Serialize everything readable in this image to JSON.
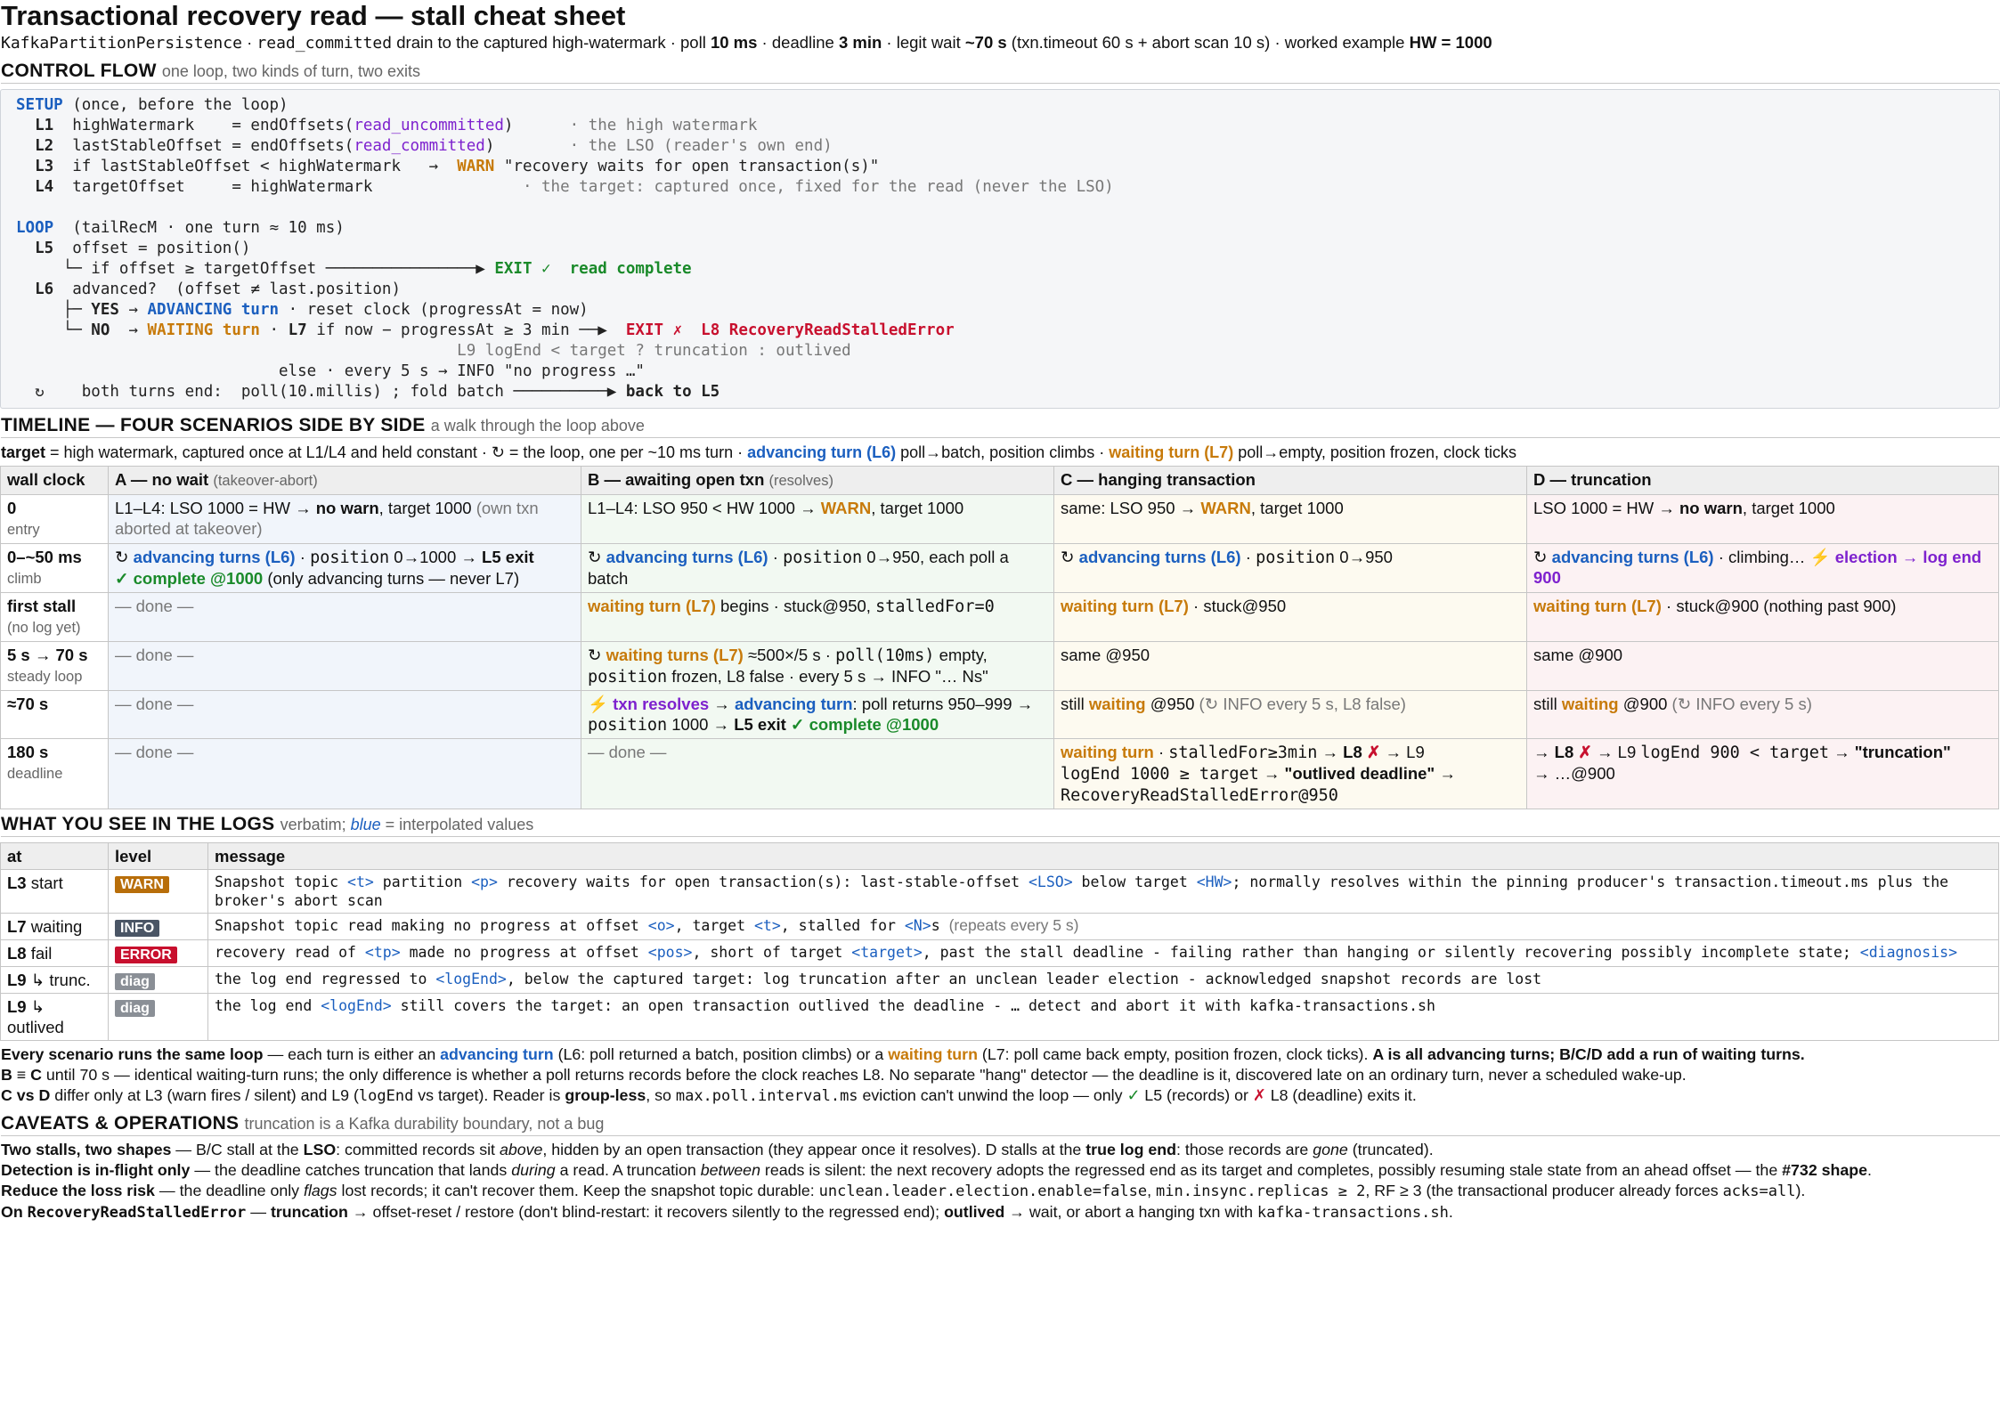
{
  "title": "Transactional recovery read — stall cheat sheet",
  "subtitle": {
    "class_name": "KafkaPartitionPersistence",
    "mode": "read_committed",
    "s1": " drain to the captured high-watermark · poll ",
    "poll": "10 ms",
    "s2": " · deadline ",
    "deadline": "3 min",
    "s3": " · legit wait ",
    "legit_wait": "~70 s",
    "s4": " (txn.timeout 60 s + abort scan 10 s) · worked example ",
    "example": "HW = 1000"
  },
  "control_flow": {
    "heading": "CONTROL FLOW",
    "note": "one loop, two kinds of turn, two exits",
    "setup_kw": "SETUP",
    "setup_note": " (once, before the loop)",
    "l1": "L1",
    "l1a": "  highWatermark    = endOffsets(",
    "l1b": "read_uncommitted",
    "l1c": ")      ",
    "l1d": "· the high watermark",
    "l2": "L2",
    "l2a": "  lastStableOffset = endOffsets(",
    "l2b": "read_committed",
    "l2c": ")        ",
    "l2d": "· the LSO (reader's own end)",
    "l3": "L3",
    "l3a": "  if lastStableOffset < highWatermark   →  ",
    "l3b": "WARN",
    "l3c": " \"recovery waits for open transaction(s)\"",
    "l4": "L4",
    "l4a": "  targetOffset     = highWatermark                ",
    "l4b": "· the target: captured once, fixed for the read (never the LSO)",
    "loop_kw": "LOOP",
    "loop_note": "  (tailRecM · one turn ≈ 10 ms)",
    "l5": "L5",
    "l5a": "  offset = position()",
    "l5b": "     └─ if offset ≥ targetOffset ────────────────▶ ",
    "l5c": "EXIT ✓  read complete",
    "l6": "L6",
    "l6a": "  advanced?  (offset ≠ last.position)",
    "l6b": "     ├─ ",
    "l6c": "YES",
    "l6d": " → ",
    "l6e": "ADVANCING turn",
    "l6f": " · reset clock (progressAt = now)",
    "l6g": "     └─ ",
    "l6h": "NO",
    "l6i": "  → ",
    "l6j": "WAITING turn",
    "l6k": " · ",
    "l6l": "L7",
    "l6m": " if now − progressAt ≥ 3 min ──▶  ",
    "l6n": "EXIT ✗  L8 RecoveryReadStalledError",
    "l9": "                                               L9 logEnd < target ? truncation : outlived",
    "else": "                            else · every 5 s → INFO \"no progress …\"",
    "loop_icon": "↻",
    "end_a": "    both turns end:  poll(10.millis) ; fold batch ──────────▶ ",
    "end_b": "back to L5"
  },
  "timeline": {
    "heading": "TIMELINE — FOUR SCENARIOS SIDE BY SIDE",
    "note": "a walk through the loop above",
    "legend": {
      "a1": "target",
      "a2": " = high watermark, captured once at L1/L4 and held constant · ↻ = the loop, one per ~10 ms turn · ",
      "a3": "advancing turn (L6)",
      "a4": " poll→batch, position climbs · ",
      "a5": "waiting turn (L7)",
      "a6": " poll→empty, position frozen, clock ticks"
    },
    "headers": {
      "wall": "wall clock",
      "a": "A — no wait",
      "a_note": "(takeover-abort)",
      "b": "B — awaiting open txn",
      "b_note": "(resolves)",
      "c": "C — hanging transaction",
      "d": "D — truncation"
    },
    "rows": {
      "r0": {
        "t": "0",
        "s": "entry"
      },
      "r1": {
        "t": "0–~50 ms",
        "s": "climb"
      },
      "r2": {
        "t": "first stall",
        "s": "(no log yet)"
      },
      "r3": {
        "t": "5 s → 70 s",
        "s": "steady loop"
      },
      "r4": {
        "t": "≈70 s"
      },
      "r5": {
        "t": "180 s",
        "s": "deadline"
      }
    },
    "cells": {
      "r0a1": "L1–L4: LSO 1000 = HW → ",
      "r0a2": "no warn",
      "r0a3": ", target 1000 ",
      "r0a4": "(own txn aborted at takeover)",
      "r0b1": "L1–L4: LSO 950 < HW 1000 → ",
      "r0b2": "WARN",
      "r0b3": ", target 1000",
      "r0c1": "same: LSO 950 → ",
      "r0c2": "WARN",
      "r0c3": ", target 1000",
      "r0d1": "LSO 1000 = HW → ",
      "r0d2": "no warn",
      "r0d3": ", target 1000",
      "r1a1": "↻ ",
      "r1a2": "advancing turns (L6)",
      "r1a3": " · ",
      "r1a4": "position",
      "r1a5": " 0→1000 → ",
      "r1a6": "L5 exit",
      "r1a7": "✓ complete @1000",
      "r1a8": " (only advancing turns — never L7)",
      "r1b1": "↻ ",
      "r1b2": "advancing turns (L6)",
      "r1b3": " · ",
      "r1b4": "position",
      "r1b5": " 0→950, each poll a batch",
      "r1c1": "↻ ",
      "r1c2": "advancing turns (L6)",
      "r1c3": " · ",
      "r1c4": "position",
      "r1c5": " 0→950",
      "r1d1": "↻ ",
      "r1d2": "advancing turns (L6)",
      "r1d3": " · climbing… ",
      "r1d4": "⚡ election → log end 900",
      "done": "— done —",
      "r2b1": "waiting turn (L7)",
      "r2b2": " begins · stuck@950, ",
      "r2b3": "stalledFor=0",
      "r2c1": "waiting turn (L7)",
      "r2c2": " · stuck@950",
      "r2d1": "waiting turn (L7)",
      "r2d2": " · stuck@900 (nothing past 900)",
      "r3b1": "↻ ",
      "r3b2": "waiting turns (L7)",
      "r3b3": " ≈500×/5 s · ",
      "r3b4": "poll(10ms)",
      "r3b5": " empty, ",
      "r3b6": "position",
      "r3b7": " frozen, L8 false · every 5 s → INFO \"… Ns\"",
      "r3c1": "same @950",
      "r3d1": "same @900",
      "r4b1": "⚡ txn resolves",
      "r4b2": " → ",
      "r4b3": "advancing turn",
      "r4b4": ": poll returns 950–999 → ",
      "r4b5": "position",
      "r4b6": " 1000 → ",
      "r4b7": "L5 exit",
      "r4b8": " ✓ complete @1000",
      "r4c1": "still ",
      "r4c2": "waiting",
      "r4c3": " @950  ",
      "r4c4": "(↻ INFO every 5 s, L8 false)",
      "r4d1": "still ",
      "r4d2": "waiting",
      "r4d3": " @900  ",
      "r4d4": "(↻ INFO every 5 s)",
      "r5c1": "waiting turn",
      "r5c2": " · ",
      "r5c3": "stalledFor≥3min",
      "r5c4": " → ",
      "r5c5": "L8",
      "r5c6": " ✗",
      "r5c7": " → L9 ",
      "r5c8": "logEnd 1000 ≥ target",
      "r5c9": " → ",
      "r5c10": "\"outlived deadline\"",
      "r5c11": " → ",
      "r5c12": "RecoveryReadStalledError@950",
      "r5d1": "→ ",
      "r5d2": "L8",
      "r5d3": " ✗",
      "r5d4": " → L9 ",
      "r5d5": "logEnd 900 < target",
      "r5d6": " → ",
      "r5d7": "\"truncation\"",
      "r5d8": " → …@900"
    }
  },
  "logs": {
    "heading": "WHAT YOU SEE IN THE LOGS",
    "note_a": "verbatim; ",
    "note_b": "blue",
    "note_c": " = interpolated values",
    "headers": {
      "at": "at",
      "level": "level",
      "message": "message"
    },
    "rows": [
      {
        "at_a": "L3",
        "at_b": " start",
        "level": "WARN"
      },
      {
        "at_a": "L7",
        "at_b": " waiting",
        "level": "INFO"
      },
      {
        "at_a": "L8",
        "at_b": " fail",
        "level": "ERROR"
      },
      {
        "at_a": "L9",
        "at_b": " ↳ trunc.",
        "level": "diag"
      },
      {
        "at_a": "L9",
        "at_b": " ↳ outlived",
        "level": "diag"
      }
    ],
    "m0": {
      "a": "Snapshot topic ",
      "b": "<t>",
      "c": " partition ",
      "d": "<p>",
      "e": " recovery waits for open transaction(s): last-stable-offset ",
      "f": "<LSO>",
      "g": " below target ",
      "h": "<HW>",
      "i": "; normally resolves within the pinning producer's transaction.timeout.ms plus the broker's abort scan"
    },
    "m1": {
      "a": "Snapshot topic read making no progress at offset ",
      "b": "<o>",
      "c": ", target ",
      "d": "<t>",
      "e": ", stalled for ",
      "f": "<N>",
      "g": "s  ",
      "h": "(repeats every 5 s)"
    },
    "m2": {
      "a": "recovery read of ",
      "b": "<tp>",
      "c": " made no progress at offset ",
      "d": "<pos>",
      "e": ", short of target ",
      "f": "<target>",
      "g": ", past the stall deadline - failing rather than hanging or silently recovering possibly incomplete state; ",
      "h": "<diagnosis>"
    },
    "m3": {
      "a": "the log end regressed to ",
      "b": "<logEnd>",
      "c": ", below the captured target: log truncation after an unclean leader election - acknowledged snapshot records are lost"
    },
    "m4": {
      "a": "the log end ",
      "b": "<logEnd>",
      "c": " still covers the target: an open transaction outlived the deadline - … detect and abort it with kafka-transactions.sh"
    }
  },
  "summary": {
    "p1": {
      "a": "Every scenario runs the same loop",
      "b": " — each turn is either an ",
      "c": "advancing turn",
      "d": " (L6: poll returned a batch, position climbs) or a ",
      "e": "waiting turn",
      "f": " (L7: poll came back empty, position frozen, clock ticks). ",
      "g": "A is all advancing turns; B/C/D add a run of waiting turns."
    },
    "p2": {
      "a": "B ≡ C",
      "b": " until 70 s — identical waiting-turn runs; the only difference is whether a poll returns records before the clock reaches L8. No separate \"hang\" detector — the deadline is it, discovered late on an ordinary turn, never a scheduled wake-up."
    },
    "p3": {
      "a": "C vs D",
      "b": " differ only at L3 (warn fires / silent) and L9 (",
      "c": "logEnd",
      "d": " vs target). Reader is ",
      "e": "group-less",
      "f": ", so ",
      "g": "max.poll.interval.ms",
      "h": " eviction can't unwind the loop — only ",
      "i": "✓",
      "j": " L5 (records) or ",
      "k": "✗",
      "l": " L8 (deadline) exits it."
    }
  },
  "caveats": {
    "heading": "CAVEATS & OPERATIONS",
    "note": "truncation is a Kafka durability boundary, not a bug",
    "c1": {
      "a": "Two stalls, two shapes",
      "b": " — B/C stall at the ",
      "c": "LSO",
      "d": ": committed records sit ",
      "e": "above",
      "f": ", hidden by an open transaction (they appear once it resolves). D stalls at the ",
      "g": "true log end",
      "h": ": those records are ",
      "i": "gone",
      "j": " (truncated)."
    },
    "c2": {
      "a": "Detection is in-flight only",
      "b": " — the deadline catches truncation that lands ",
      "c": "during",
      "d": " a read. A truncation ",
      "e": "between",
      "f": " reads is silent: the next recovery adopts the regressed end as its target and completes, possibly resuming stale state from an ahead offset — the ",
      "g": "#732 shape",
      "h": "."
    },
    "c3": {
      "a": "Reduce the loss risk",
      "b": " — the deadline only ",
      "c": "flags",
      "d": " lost records; it can't recover them. Keep the snapshot topic durable: ",
      "e": "unclean.leader.election.enable=false",
      "f": ", ",
      "g": "min.insync.replicas ≥ 2",
      "h": ", RF ≥ 3 (the transactional producer already forces ",
      "i": "acks=all",
      "j": ")."
    },
    "c4": {
      "a": "On ",
      "b": "RecoveryReadStalledError",
      "c": " — ",
      "d": "truncation",
      "e": " → offset-reset / restore (don't blind-restart: it recovers silently to the regressed end); ",
      "f": "outlived",
      "g": " → wait, or abort a hanging txn with ",
      "h": "kafka-transactions.sh",
      "i": "."
    }
  }
}
